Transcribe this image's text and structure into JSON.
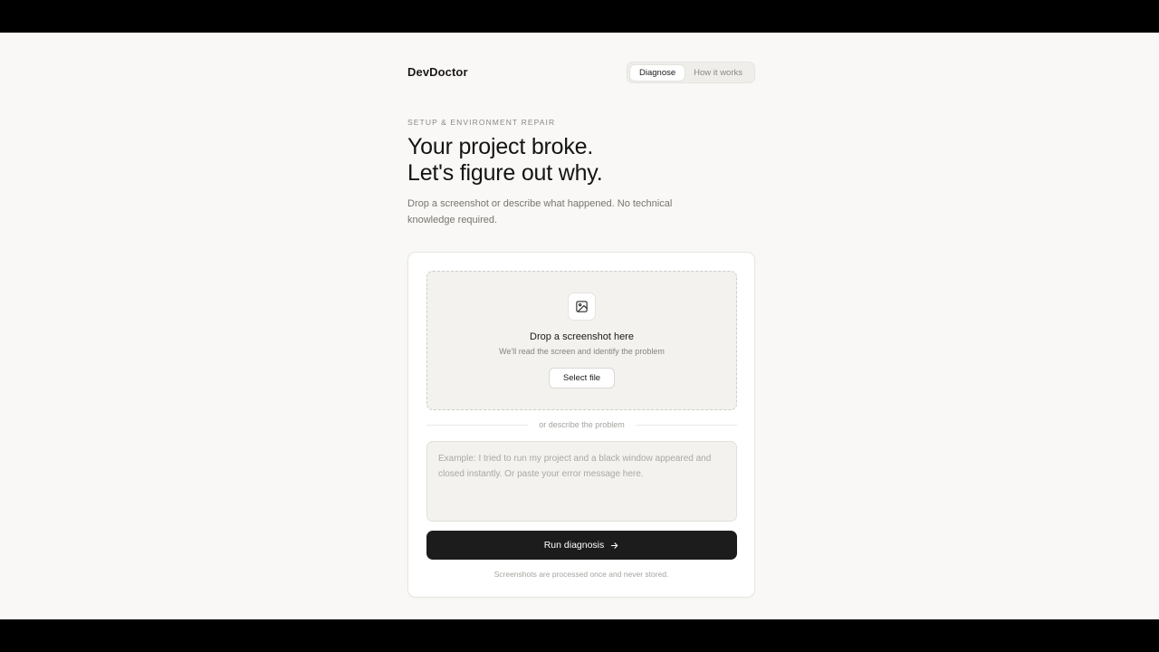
{
  "header": {
    "brand": "DevDoctor",
    "tabs": [
      {
        "label": "Diagnose",
        "active": true
      },
      {
        "label": "How it works",
        "active": false
      }
    ]
  },
  "hero": {
    "eyebrow": "SETUP & ENVIRONMENT REPAIR",
    "headline_line1": "Your project broke.",
    "headline_line2": "Let's figure out why.",
    "subtitle": "Drop a screenshot or describe what happened. No technical knowledge required."
  },
  "upload": {
    "icon": "image-icon",
    "title": "Drop a screenshot here",
    "subtitle": "We'll read the screen and identify the problem",
    "button_label": "Select file"
  },
  "divider_text": "or describe the problem",
  "description": {
    "value": "",
    "placeholder": "Example: I tried to run my project and a black window appeared and closed instantly. Or paste your error message here."
  },
  "run_button": {
    "label": "Run diagnosis",
    "icon": "arrow-right-icon"
  },
  "footnote": "Screenshots are processed once and never stored.",
  "colors": {
    "page_background": "#f9f8f6",
    "letterbox": "#000000",
    "primary_button": "#1c1c1c",
    "dropzone": "#f3f2ee"
  }
}
